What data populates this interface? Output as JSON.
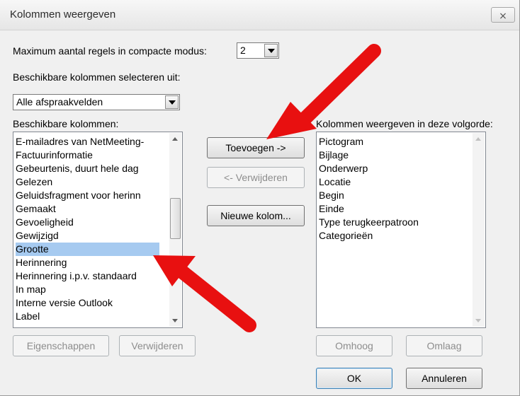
{
  "window": {
    "title": "Kolommen weergeven",
    "close_glyph": "⨯"
  },
  "max_rows": {
    "label": "Maximum aantal regels in compacte modus:",
    "value": "2"
  },
  "select_from": {
    "label": "Beschikbare kolommen selecteren uit:",
    "value": "Alle afspraakvelden"
  },
  "available": {
    "label": "Beschikbare kolommen:",
    "items": [
      "E-mailadres van NetMeeting-",
      "Factuurinformatie",
      "Gebeurtenis, duurt hele dag",
      "Gelezen",
      "Geluidsfragment voor herinn",
      "Gemaakt",
      "Gevoeligheid",
      "Gewijzigd",
      "Grootte",
      "Herinnering",
      "Herinnering i.p.v. standaard",
      "In map",
      "Interne versie Outlook",
      "Label"
    ],
    "selected": "Grootte"
  },
  "shown": {
    "label": "Kolommen weergeven in deze volgorde:",
    "items": [
      "Pictogram",
      "Bijlage",
      "Onderwerp",
      "Locatie",
      "Begin",
      "Einde",
      "Type terugkeerpatroon",
      "Categorieën"
    ]
  },
  "buttons": {
    "add": "Toevoegen ->",
    "remove": "<- Verwijderen",
    "new_column": "Nieuwe kolom...",
    "properties": "Eigenschappen",
    "delete": "Verwijderen",
    "up": "Omhoog",
    "down": "Omlaag",
    "ok": "OK",
    "cancel": "Annuleren"
  },
  "colors": {
    "annotation_arrow": "#e81010",
    "selection": "#a6caf0"
  }
}
